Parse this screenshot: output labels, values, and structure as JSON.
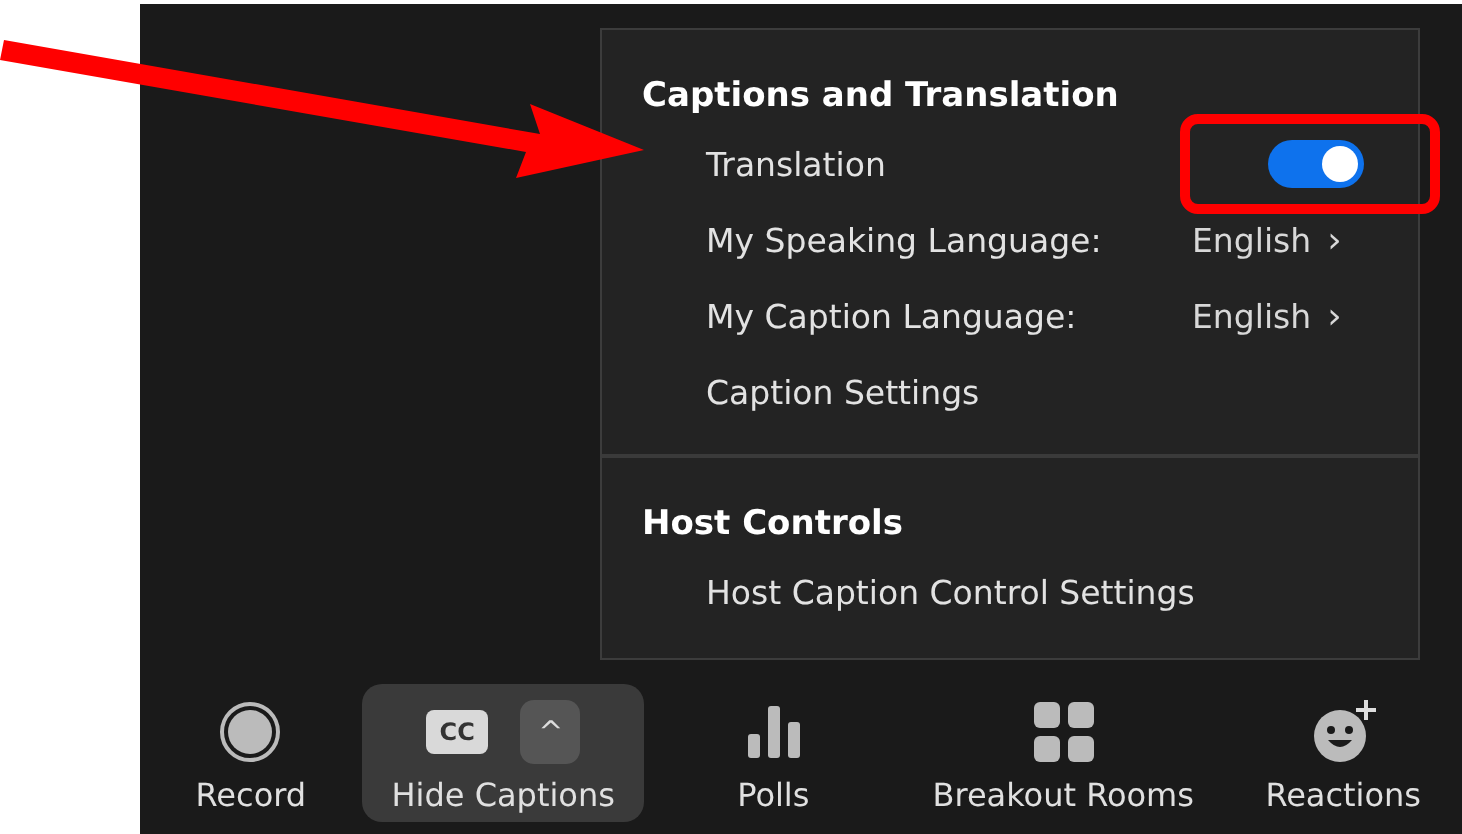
{
  "menu": {
    "sections": [
      {
        "heading": "Captions and Translation",
        "items": [
          {
            "kind": "toggle",
            "label": "Translation",
            "on": true
          },
          {
            "kind": "submenu",
            "label": "My Speaking Language:",
            "value": "English",
            "chevron": "›"
          },
          {
            "kind": "submenu",
            "label": "My Caption Language:",
            "value": "English",
            "chevron": "›"
          },
          {
            "kind": "action",
            "label": "Caption Settings"
          }
        ]
      },
      {
        "heading": "Host Controls",
        "items": [
          {
            "kind": "action",
            "label": "Host Caption Control Settings"
          }
        ]
      }
    ]
  },
  "toolbar": [
    {
      "kind": "record",
      "label": "Record",
      "selected": false
    },
    {
      "kind": "captions",
      "label": "Hide Captions",
      "badge": "CC",
      "caret": "^",
      "selected": true
    },
    {
      "kind": "polls",
      "label": "Polls",
      "selected": false
    },
    {
      "kind": "breakout",
      "label": "Breakout Rooms",
      "selected": false
    },
    {
      "kind": "reactions",
      "label": "Reactions",
      "selected": false
    }
  ]
}
